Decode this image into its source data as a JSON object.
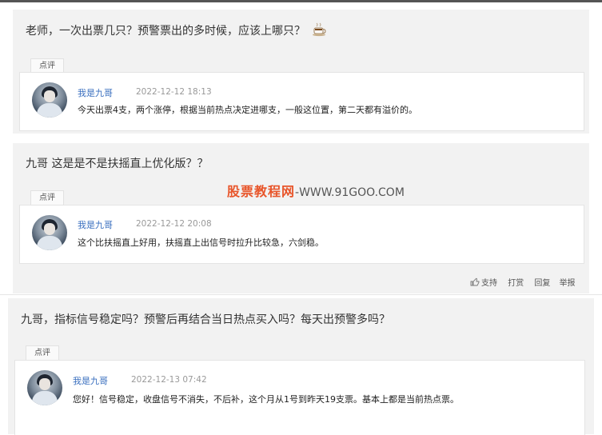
{
  "posts": [
    {
      "question": "老师，一次出票几只？预警票出的多时候，应该上哪只？",
      "tab": "点评",
      "author": "我是九哥",
      "time": "2022-12-12 18:13",
      "reply": "今天出票4支，两个涨停，根据当前热点决定进哪支，一般这位置，第二天都有溢价的。",
      "emoji_icon": "coffee-cup-icon"
    },
    {
      "question": "九哥  这是是不是扶摇直上优化版？？",
      "tab": "点评",
      "author": "我是九哥",
      "time": "2022-12-12 20:08",
      "reply": "这个比扶摇直上好用，扶摇直上出信号时拉升比较急，六剑稳。"
    },
    {
      "question": "九哥，指标信号稳定吗？预警后再结合当日热点买入吗？每天出预警多吗？",
      "tab": "点评",
      "author": "我是九哥",
      "time": "2022-12-13 07:42",
      "reply": "您好！信号稳定，收盘信号不消失，不后补，这个月从1号到昨天19支票。基本上都是当前热点票。"
    }
  ],
  "watermark": {
    "brand": "股票教程网",
    "url": "-WWW.91GOO.COM"
  },
  "actions": {
    "support": "支持",
    "tip": "打赏",
    "reply": "回复",
    "report": "举报"
  }
}
